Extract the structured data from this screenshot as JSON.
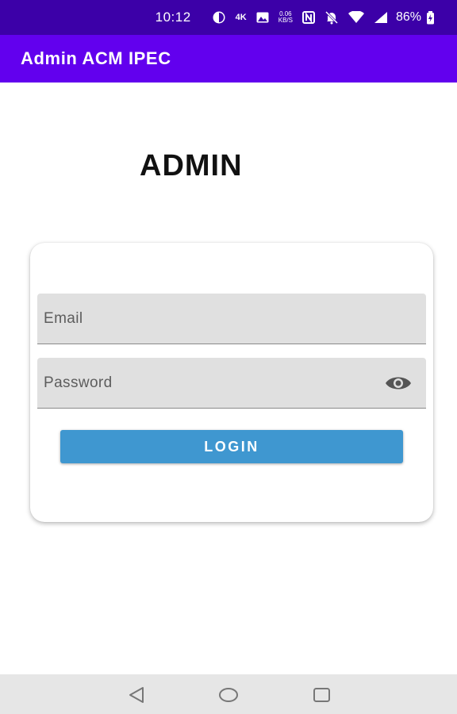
{
  "status_bar": {
    "time": "10:12",
    "network_type": "4K",
    "speed_value": "0.06",
    "speed_unit": "KB/S",
    "battery": "86%",
    "icons": [
      "data-saver-icon",
      "4k-icon",
      "image-icon",
      "speed-icon",
      "nfc-icon",
      "mute-icon",
      "wifi-icon",
      "signal-icon",
      "battery-icon"
    ]
  },
  "app_bar": {
    "title": "Admin ACM IPEC"
  },
  "page": {
    "heading": "ADMIN"
  },
  "form": {
    "email": {
      "placeholder": "Email",
      "value": ""
    },
    "password": {
      "placeholder": "Password",
      "value": ""
    },
    "password_toggle_icon": "eye-icon",
    "login_label": "LOGIN"
  },
  "nav": {
    "icons": [
      "back-icon",
      "home-icon",
      "recents-icon"
    ]
  },
  "colors": {
    "status_bar": "#3c00a8",
    "app_bar": "#6200ee",
    "field_bg": "#e0e0e0",
    "login_button": "#3f97d0",
    "nav_bar": "#e6e6e6"
  }
}
